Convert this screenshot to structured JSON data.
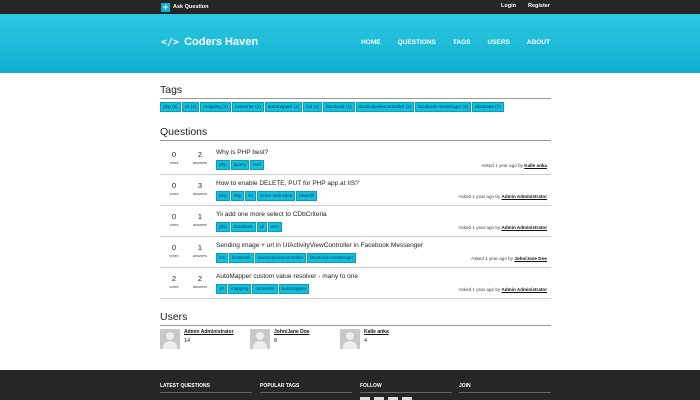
{
  "topbar": {
    "ask_label": "Ask Question",
    "login_label": "Login",
    "register_label": "Register"
  },
  "header": {
    "logo_text": "Coders Haven",
    "nav": [
      "HOME",
      "QUESTIONS",
      "TAGS",
      "USERS",
      "ABOUT"
    ]
  },
  "tags_section": {
    "title": "Tags",
    "tags": [
      "php (3)",
      "c# (1)",
      "mapping (1)",
      "converter (1)",
      "automapper (1)",
      "ios (1)",
      "facebook (1)",
      "uiactivityviewcontroller (1)",
      "facebook-messenger (1)",
      "database (1)"
    ]
  },
  "questions_section": {
    "title": "Questions",
    "questions": [
      {
        "votes": "0",
        "votes_label": "votes",
        "answers": "2",
        "answers_label": "answers",
        "title": "Why is PHP best?",
        "tags": [
          "php",
          "jquery",
          "troll"
        ],
        "asked": "Asked 1 year ago by",
        "user": "Kalle anka"
      },
      {
        "votes": "0",
        "votes_label": "votes",
        "answers": "3",
        "answers_label": "answers",
        "title": "How to enable DELETE, PUT for PHP app at IIS?",
        "tags": [
          "php",
          "http",
          "iis",
          "azure-web-sites",
          "cleardb"
        ],
        "asked": "Asked 1 year ago by",
        "user": "Admin Administrator"
      },
      {
        "votes": "0",
        "votes_label": "votes",
        "answers": "1",
        "answers_label": "answers",
        "title": "Yii add one more select to CDbCriteria",
        "tags": [
          "php",
          "database",
          "yii",
          "orm"
        ],
        "asked": "Asked 1 year ago by",
        "user": "Admin Administrator"
      },
      {
        "votes": "0",
        "votes_label": "votes",
        "answers": "1",
        "answers_label": "answers",
        "title": "Sending image + url in UIActivityViewController in Facebook Messenger",
        "tags": [
          "ios",
          "facebook",
          "uiactivityviewcontroller",
          "facebook-messenger"
        ],
        "asked": "Asked 1 year ago by",
        "user": "John/Jane Doe"
      },
      {
        "votes": "2",
        "votes_label": "votes",
        "answers": "2",
        "answers_label": "answers",
        "title": "AutoMapper custom value resolver - many to one",
        "tags": [
          "c#",
          "mapping",
          "converter",
          "automapper"
        ],
        "asked": "Asked 1 year ago by",
        "user": "Admin Administrator"
      }
    ]
  },
  "users_section": {
    "title": "Users",
    "users": [
      {
        "name": "Admin Administrator",
        "rep": "14"
      },
      {
        "name": "John/Jane Doe",
        "rep": "8"
      },
      {
        "name": "Kalle anka",
        "rep": "4"
      }
    ]
  },
  "footer": {
    "columns": [
      "LATEST QUESTIONS",
      "POPULAR TAGS",
      "FOLLOW",
      "JOIN"
    ]
  },
  "colors": {
    "accent": "#13bfde",
    "dark": "#262626"
  }
}
